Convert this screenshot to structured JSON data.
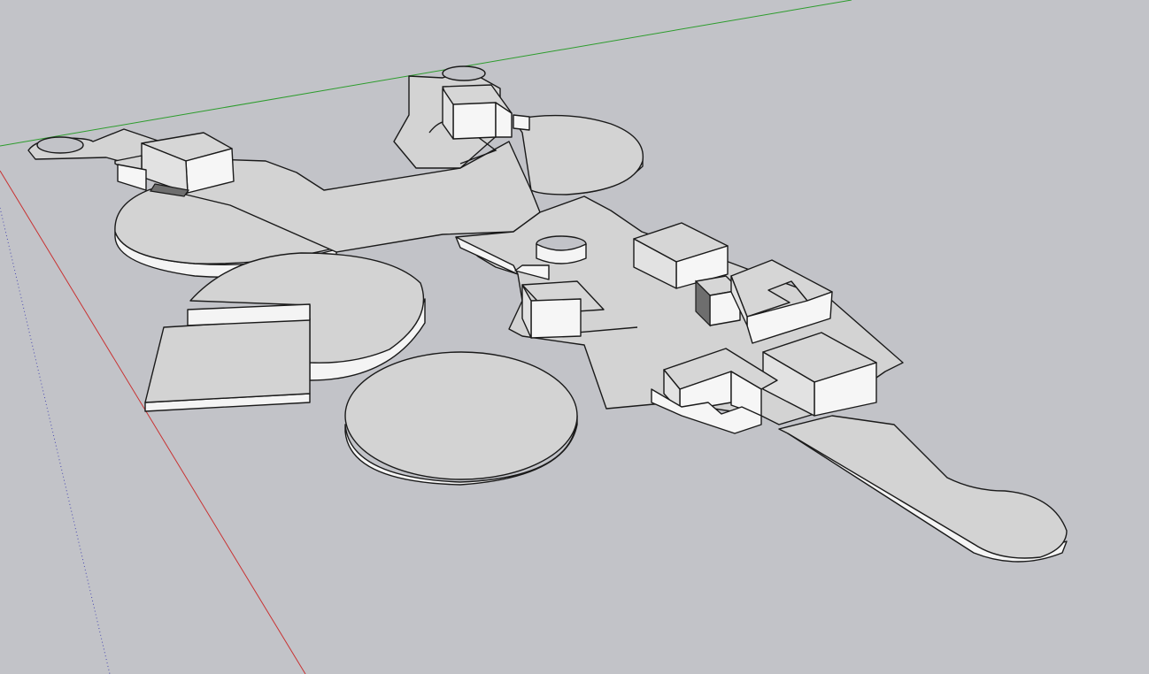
{
  "viewport": {
    "background": "#c2c3c8",
    "axis_colors": {
      "green_axis": "#2c9c2c",
      "red_axis": "#c83232",
      "blue_axis_dotted": "#4a4ab0"
    },
    "face_colors": {
      "top": "#d3d3d3",
      "side": "#f4f4f4",
      "edge": "#1a1a1a"
    }
  }
}
